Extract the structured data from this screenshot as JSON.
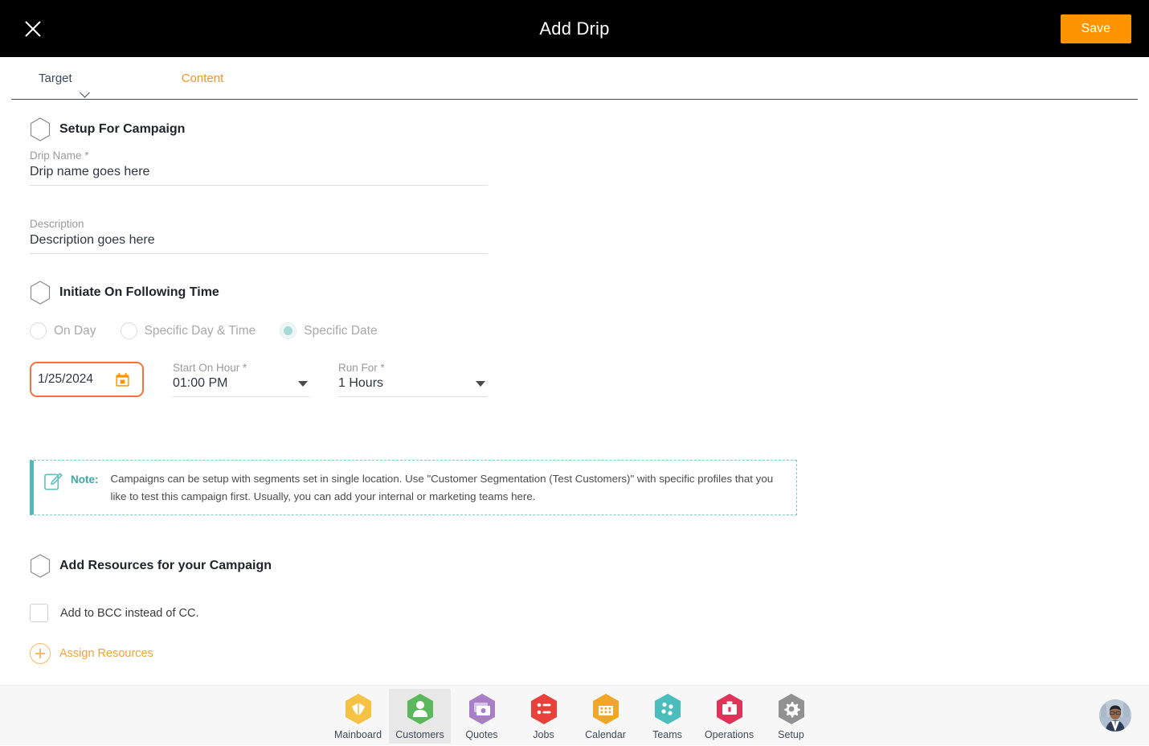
{
  "header": {
    "title": "Add Drip",
    "close_icon": "close-icon",
    "save_label": "Save"
  },
  "tabs": [
    {
      "label": "Target",
      "active": true
    },
    {
      "label": "Content",
      "active": false
    }
  ],
  "sections": {
    "setup": {
      "title": "Setup For Campaign",
      "fields": [
        {
          "label": "Drip Name *",
          "value": "Drip name goes here",
          "placeholder": "Drip name goes here"
        },
        {
          "label": "Description",
          "value": "Description goes here",
          "placeholder": "Description goes here"
        }
      ]
    },
    "initiate": {
      "title": "Initiate On Following Time",
      "radios": [
        {
          "label": "On Day",
          "checked": false
        },
        {
          "label": "Specific Day & Time",
          "checked": false
        },
        {
          "label": "Specific Date",
          "checked": true
        }
      ],
      "date": {
        "value": "1/25/2024",
        "icon": "calendar-icon"
      },
      "start_on_hour": {
        "label": "Start On Hour *",
        "value": "01:00 PM"
      },
      "run_for": {
        "label": "Run For *",
        "value": "1 Hours"
      }
    },
    "note": {
      "icon": "note-edit-icon",
      "label": "Note:",
      "text": "Campaigns can be setup with segments set in single location. Use \"Customer Segmentation (Test Customers)\" with specific profiles that you like to test this campaign first. Usually, you can add your internal or marketing teams here."
    },
    "resources": {
      "title": "Add Resources for your Campaign",
      "checkbox": {
        "label": "Add to BCC instead of CC.",
        "checked": false
      },
      "assign": {
        "label": "Assign Resources",
        "icon": "plus-circle-icon"
      }
    }
  },
  "bottom_nav": {
    "items": [
      {
        "label": "Mainboard",
        "icon": "mainboard-icon",
        "color": "#f6c243",
        "active": false
      },
      {
        "label": "Customers",
        "icon": "customers-icon",
        "color": "#5cb85c",
        "active": true
      },
      {
        "label": "Quotes",
        "icon": "quotes-icon",
        "color": "#a87ec7",
        "active": false
      },
      {
        "label": "Jobs",
        "icon": "jobs-icon",
        "color": "#e8403a",
        "active": false
      },
      {
        "label": "Calendar",
        "icon": "calendar-icon",
        "color": "#f0a629",
        "active": false
      },
      {
        "label": "Teams",
        "icon": "teams-icon",
        "color": "#4cbdbd",
        "active": false
      },
      {
        "label": "Operations",
        "icon": "operations-icon",
        "color": "#e0335a",
        "active": false
      },
      {
        "label": "Setup",
        "icon": "setup-gear-icon",
        "color": "#919191",
        "active": false
      }
    ],
    "avatar": "user-avatar"
  },
  "colors": {
    "accent_orange": "#fd9400",
    "focus_orange": "#f8703c",
    "teal": "#54b8b3",
    "header_bg": "#000000"
  }
}
